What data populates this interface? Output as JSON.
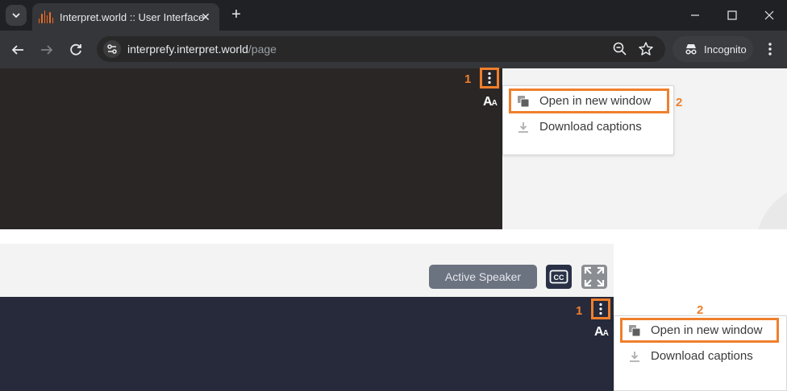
{
  "browser": {
    "tab_title": "Interpret.world :: User Interface",
    "new_tab_symbol": "+",
    "close_symbol": "✕",
    "url_host": "interprefy.interpret.world",
    "url_path": "/page",
    "incognito_label": "Incognito"
  },
  "top_panel": {
    "step1": "1",
    "step2": "2",
    "font_toggle": "AA",
    "menu": {
      "open_new_window": "Open in new window",
      "download_captions": "Download captions"
    }
  },
  "bottom_panel": {
    "active_speaker_label": "Active Speaker",
    "cc_label": "CC",
    "step1": "1",
    "step2": "2",
    "font_toggle": "AA",
    "menu": {
      "open_new_window": "Open in new window",
      "download_captions": "Download captions"
    }
  },
  "colors": {
    "highlight": "#f07f2c",
    "brand_favicon": "#ef6c22"
  }
}
